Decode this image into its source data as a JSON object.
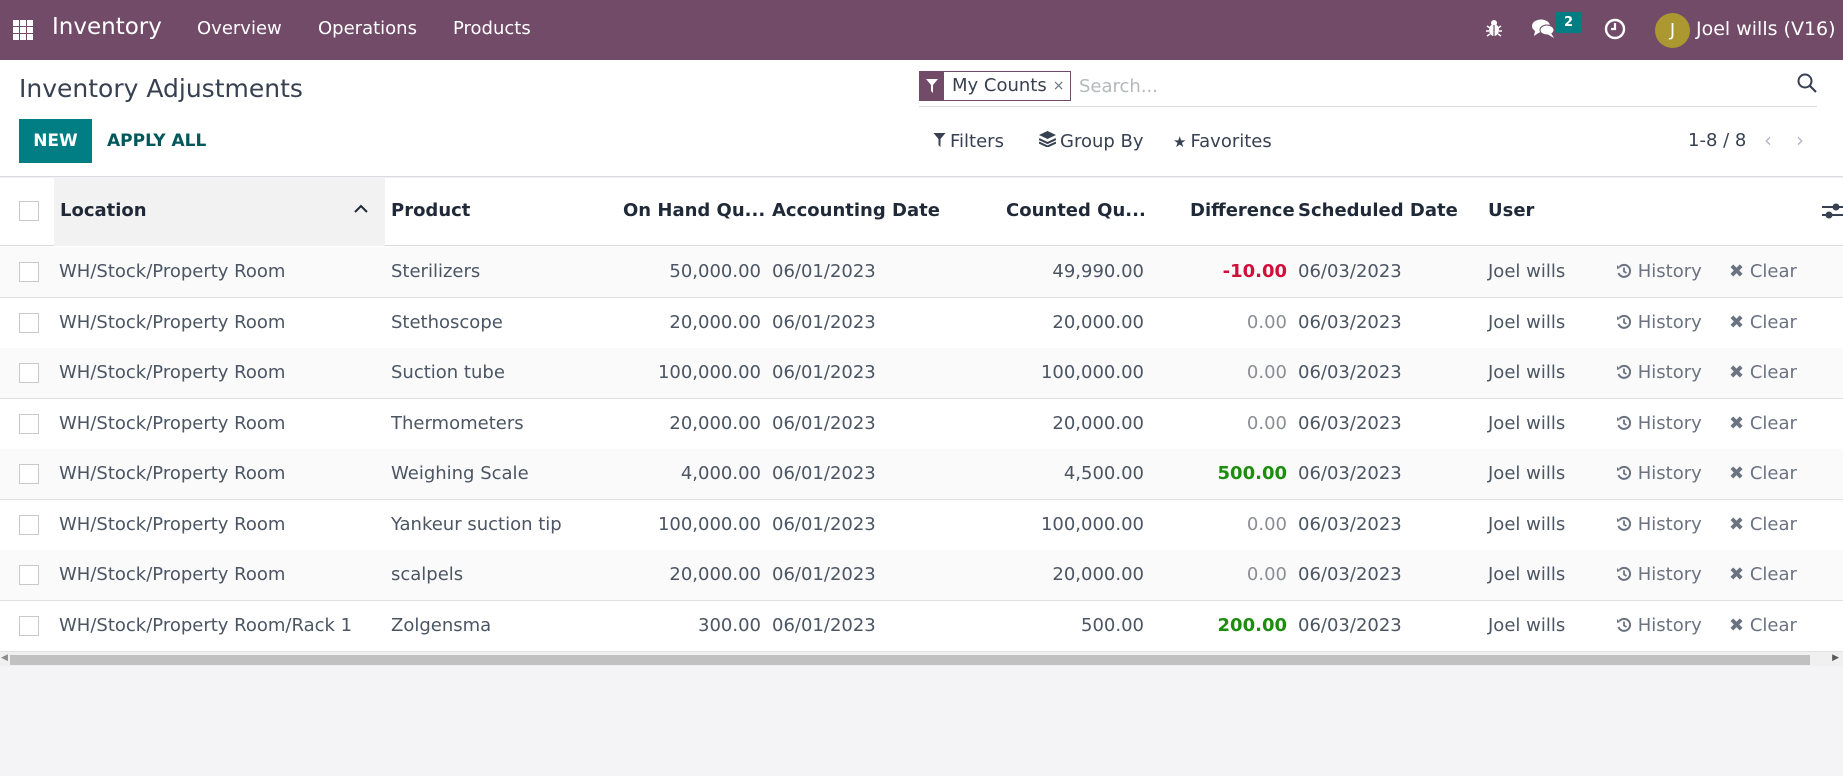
{
  "navbar": {
    "app_name": "Inventory",
    "menu": [
      "Overview",
      "Operations",
      "Products"
    ],
    "icons": {
      "apps": "apps-grid-icon",
      "debug": "bug-icon",
      "messages": "chat-icon",
      "activities": "clock-icon"
    },
    "messages_badge": "2",
    "avatar_initial": "J",
    "user_name": "Joel wills (V16)",
    "colors": {
      "brand": "#714b67",
      "badge": "#017e84",
      "avatar": "#ab9830"
    }
  },
  "control_panel": {
    "title": "Inventory Adjustments",
    "new_label": "NEW",
    "apply_all_label": "APPLY ALL",
    "search": {
      "facet_icon": "filter-icon",
      "facet_label": "My Counts",
      "facet_remove": "×",
      "placeholder": "Search...",
      "value": ""
    },
    "options": {
      "filters": "Filters",
      "group_by": "Group By",
      "favorites": "Favorites"
    },
    "pager": {
      "text": "1-8 / 8",
      "prev": "‹",
      "next": "›"
    }
  },
  "table": {
    "columns": [
      "Location",
      "Product",
      "On Hand Qu...",
      "Accounting Date",
      "Counted Qu...",
      "Difference",
      "Scheduled Date",
      "User"
    ],
    "sorted_column": "Location",
    "sort_direction": "ascending",
    "row_actions": {
      "history": "History",
      "clear": "Clear"
    },
    "rows": [
      {
        "location": "WH/Stock/Property Room",
        "product": "Sterilizers",
        "on_hand": "50,000.00",
        "accounting_date": "06/01/2023",
        "counted": "49,990.00",
        "difference": "-10.00",
        "diff_state": "neg",
        "scheduled_date": "06/03/2023",
        "user": "Joel wills"
      },
      {
        "location": "WH/Stock/Property Room",
        "product": "Stethoscope",
        "on_hand": "20,000.00",
        "accounting_date": "06/01/2023",
        "counted": "20,000.00",
        "difference": "0.00",
        "diff_state": "zero",
        "scheduled_date": "06/03/2023",
        "user": "Joel wills"
      },
      {
        "location": "WH/Stock/Property Room",
        "product": "Suction tube",
        "on_hand": "100,000.00",
        "accounting_date": "06/01/2023",
        "counted": "100,000.00",
        "difference": "0.00",
        "diff_state": "zero",
        "scheduled_date": "06/03/2023",
        "user": "Joel wills"
      },
      {
        "location": "WH/Stock/Property Room",
        "product": "Thermometers",
        "on_hand": "20,000.00",
        "accounting_date": "06/01/2023",
        "counted": "20,000.00",
        "difference": "0.00",
        "diff_state": "zero",
        "scheduled_date": "06/03/2023",
        "user": "Joel wills"
      },
      {
        "location": "WH/Stock/Property Room",
        "product": "Weighing Scale",
        "on_hand": "4,000.00",
        "accounting_date": "06/01/2023",
        "counted": "4,500.00",
        "difference": "500.00",
        "diff_state": "pos",
        "scheduled_date": "06/03/2023",
        "user": "Joel wills"
      },
      {
        "location": "WH/Stock/Property Room",
        "product": "Yankeur suction tip",
        "on_hand": "100,000.00",
        "accounting_date": "06/01/2023",
        "counted": "100,000.00",
        "difference": "0.00",
        "diff_state": "zero",
        "scheduled_date": "06/03/2023",
        "user": "Joel wills"
      },
      {
        "location": "WH/Stock/Property Room",
        "product": "scalpels",
        "on_hand": "20,000.00",
        "accounting_date": "06/01/2023",
        "counted": "20,000.00",
        "difference": "0.00",
        "diff_state": "zero",
        "scheduled_date": "06/03/2023",
        "user": "Joel wills"
      },
      {
        "location": "WH/Stock/Property Room/Rack 1",
        "product": "Zolgensma",
        "on_hand": "300.00",
        "accounting_date": "06/01/2023",
        "counted": "500.00",
        "difference": "200.00",
        "diff_state": "pos",
        "scheduled_date": "06/03/2023",
        "user": "Joel wills"
      }
    ],
    "status_colors": {
      "neg": "#d0103a",
      "pos": "#1c8e0e",
      "zero": "#8b8f95"
    }
  }
}
